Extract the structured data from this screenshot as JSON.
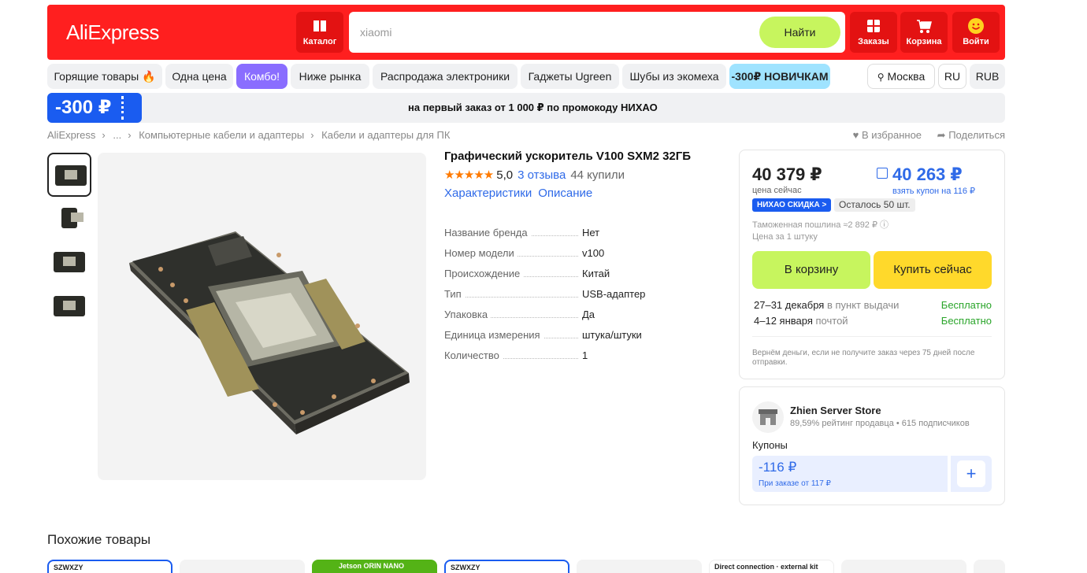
{
  "header": {
    "logo": "AliExpress",
    "catalog": "Каталог",
    "search_value": "xiaomi",
    "search_button": "Найти",
    "orders": "Заказы",
    "cart": "Корзина",
    "login": "Войти",
    "colors": {
      "brand": "#ff1f1f",
      "search_button": "#c7f55e"
    }
  },
  "chips": [
    "Горящие товары 🔥",
    "Одна цена",
    "Комбо!",
    "Ниже рынка",
    "Распродажа электроники",
    "Гаджеты Ugreen",
    "Шубы из экомеха",
    "-300₽ НОВИЧКАМ"
  ],
  "locale": {
    "city": "Москва",
    "lang": "RU",
    "currency": "RUB"
  },
  "promo": {
    "tag": "-300 ₽",
    "text": "на первый заказ от 1 000 ₽ по промокоду НИХАО"
  },
  "breadcrumb": [
    "AliExpress",
    "...",
    "Компьютерные кабели и адаптеры",
    "Кабели и адаптеры для ПК"
  ],
  "actions": {
    "favorite": "В избранное",
    "share": "Поделиться"
  },
  "product": {
    "title": "Графический ускоритель V100 SXM2 32ГБ",
    "stars": "★★★★★",
    "rating": "5,0",
    "reviews": "3 отзыва",
    "bought": "44 купили",
    "tabs": [
      "Характеристики",
      "Описание"
    ],
    "specs": [
      {
        "k": "Название бренда",
        "v": "Нет"
      },
      {
        "k": "Номер модели",
        "v": "v100"
      },
      {
        "k": "Происхождение",
        "v": "Китай"
      },
      {
        "k": "Тип",
        "v": "USB-адаптер"
      },
      {
        "k": "Упаковка",
        "v": "Да"
      },
      {
        "k": "Единица измерения",
        "v": "штука/штуки"
      },
      {
        "k": "Количество",
        "v": "1"
      }
    ]
  },
  "buybox": {
    "price": "40 379 ₽",
    "price_caption": "цена сейчас",
    "coupon_price": "40 263 ₽",
    "coupon_caption": "взять купон на 116 ₽",
    "discount_tag": "НИХАО СКИДКА >",
    "stock": "Осталось 50 шт.",
    "duty": "Таможенная пошлина ≈2 892 ₽ ⓘ",
    "unit": "Цена за 1 штуку",
    "add_to_cart": "В корзину",
    "buy_now": "Купить сейчас",
    "delivery": [
      {
        "date": "27–31 декабря",
        "where": "в пункт выдачи",
        "cost": "Бесплатно"
      },
      {
        "date": "4–12 января",
        "where": "почтой",
        "cost": "Бесплатно"
      }
    ],
    "refund": "Вернём деньги, если не получите заказ через 75 дней после отправки."
  },
  "store": {
    "name": "Zhien Server Store",
    "meta": "89,59% рейтинг продавца • 615 подписчиков",
    "coupons_title": "Купоны",
    "coupon_amount": "-116 ₽",
    "coupon_condition": "При заказе от 117 ₽"
  },
  "similar": {
    "title": "Похожие товары",
    "items": [
      "SZWXZY",
      "",
      "Jetson ORIN NANO",
      "SZWXZY",
      "",
      "Direct connection · external kit",
      "",
      ""
    ]
  }
}
